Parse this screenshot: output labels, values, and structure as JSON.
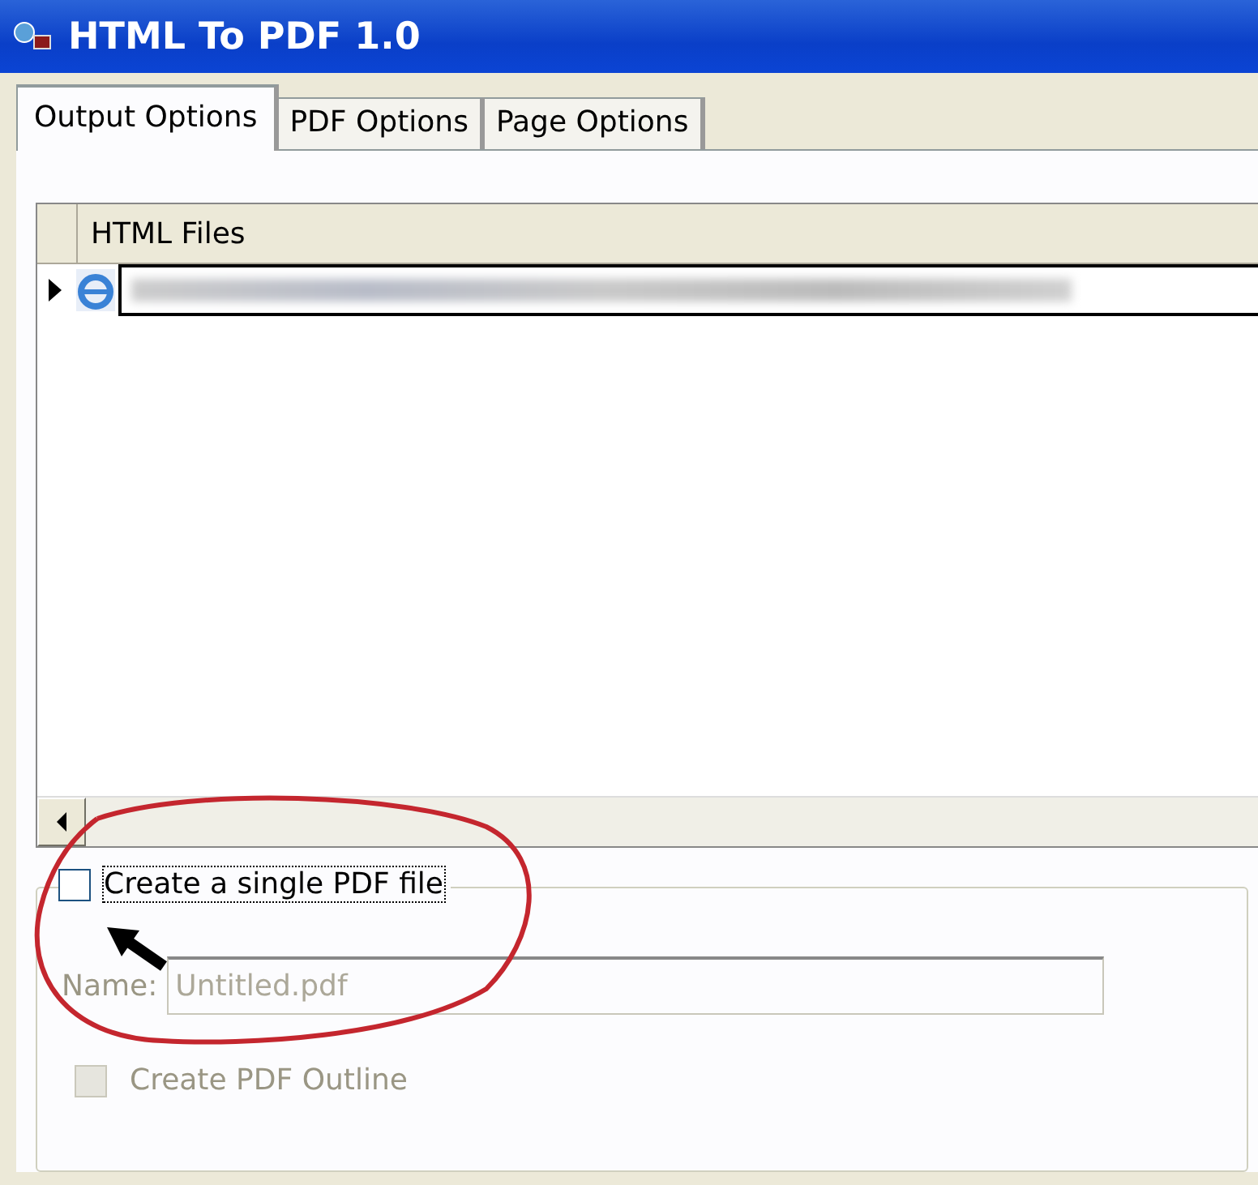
{
  "window": {
    "title": "HTML To PDF 1.0"
  },
  "tabs": [
    {
      "label": "Output Options",
      "selected": true
    },
    {
      "label": "PDF Options",
      "selected": false
    },
    {
      "label": "Page Options",
      "selected": false
    }
  ],
  "grid": {
    "columns": [
      "HTML Files"
    ],
    "rows": [
      {
        "current": true,
        "editing": true
      }
    ]
  },
  "single_pdf": {
    "label": "Create a single PDF file",
    "checked": false,
    "focused": true
  },
  "name_field": {
    "label": "Name:",
    "value": "Untitled.pdf",
    "disabled": true
  },
  "outline": {
    "label": "Create PDF Outline",
    "checked": false,
    "disabled": true
  }
}
